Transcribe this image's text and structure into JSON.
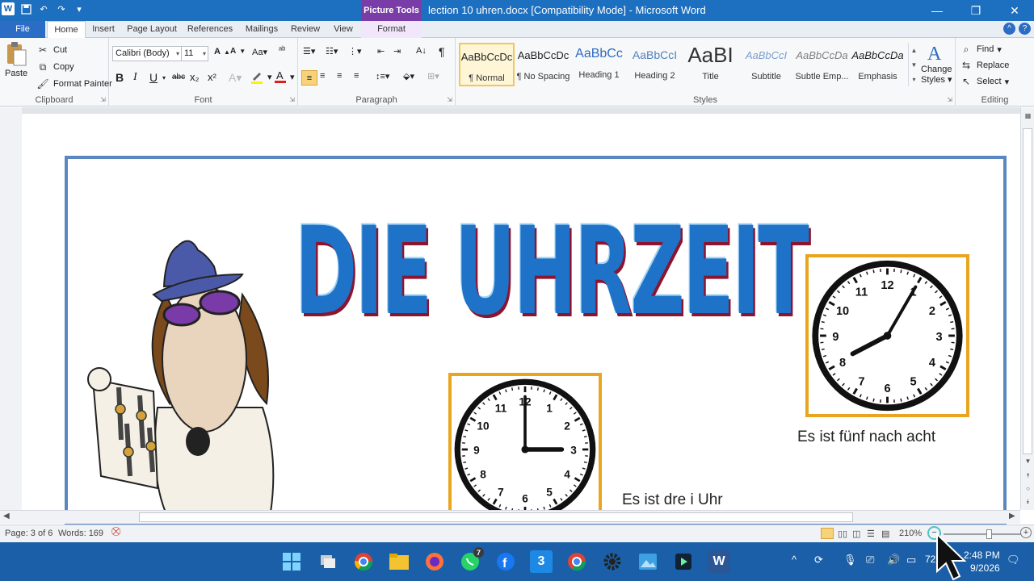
{
  "window": {
    "title": "lection 10 uhren.docx [Compatibility Mode]  -  Microsoft Word",
    "context_tab_header": "Picture Tools"
  },
  "tabs": [
    "File",
    "Home",
    "Insert",
    "Page Layout",
    "References",
    "Mailings",
    "Review",
    "View",
    "Format"
  ],
  "clipboard": {
    "paste": "Paste",
    "cut": "Cut",
    "copy": "Copy",
    "format_painter": "Format Painter",
    "label": "Clipboard"
  },
  "font": {
    "family": "Calibri (Body)",
    "size": "11",
    "label": "Font"
  },
  "paragraph": {
    "label": "Paragraph"
  },
  "styles": {
    "label": "Styles",
    "items": [
      {
        "preview": "AaBbCcDc",
        "name": "¶ Normal"
      },
      {
        "preview": "AaBbCcDc",
        "name": "¶ No Spacing"
      },
      {
        "preview": "AaBbCc",
        "name": "Heading 1"
      },
      {
        "preview": "AaBbCcI",
        "name": "Heading 2"
      },
      {
        "preview": "AaBI",
        "name": "Title"
      },
      {
        "preview": "AaBbCcI",
        "name": "Subtitle"
      },
      {
        "preview": "AaBbCcDa",
        "name": "Subtle Emp..."
      },
      {
        "preview": "AaBbCcDa",
        "name": "Emphasis"
      }
    ],
    "change_styles_1": "Change",
    "change_styles_2": "Styles"
  },
  "editing": {
    "find": "Find",
    "replace": "Replace",
    "select": "Select",
    "label": "Editing"
  },
  "document": {
    "headline": "DIE UHRZEIT",
    "caption_1": "Es ist fünf nach acht",
    "caption_2": "Es ist dre i  Uhr",
    "clock_1": {
      "hour": 8,
      "minute": 5
    },
    "clock_2": {
      "hour": 3,
      "minute": 0
    },
    "clock_numbers": [
      "12",
      "1",
      "2",
      "3",
      "4",
      "5",
      "6",
      "7",
      "8",
      "9",
      "10",
      "11"
    ]
  },
  "status": {
    "page": "Page: 3 of 6",
    "words": "Words: 169",
    "zoom": "210%"
  },
  "taskbar": {
    "whatsapp_badge": "7",
    "app_3": "3",
    "battery": "72",
    "time": "2:48 PM",
    "date": "9/2026"
  },
  "colors": {
    "titlebar": "#1d6fc0",
    "picture_tools": "#7a3da8",
    "headline": "#1e73c8",
    "clock_border": "#e9a520",
    "frame": "#5b87c0"
  }
}
